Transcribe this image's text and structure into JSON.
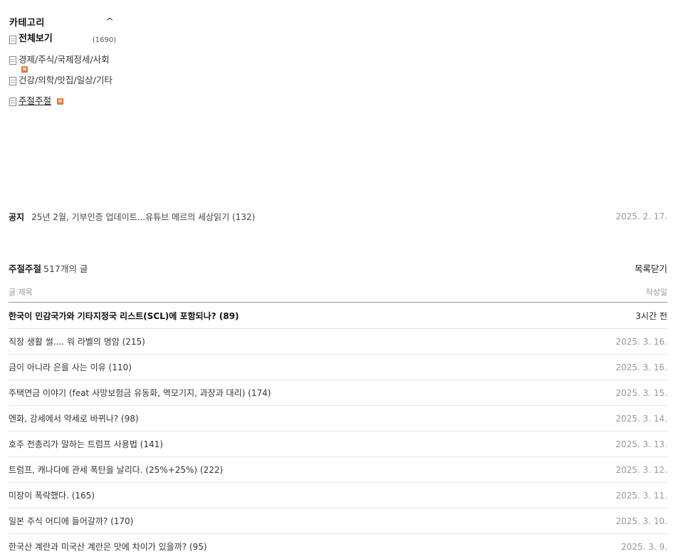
{
  "category": {
    "title": "카테고리",
    "collapse_icon": "caret-up-icon",
    "items": [
      {
        "label": "전체보기",
        "count": "(1690)"
      },
      {
        "label": "경제/주식/국제정세/사회",
        "badge": "N"
      },
      {
        "label": "건강/의학/맛집/일상/기타"
      },
      {
        "label": "주절주절",
        "badge": "N"
      }
    ]
  },
  "notice": {
    "label": "공지",
    "text": "25년 2월, 기부인증 업데이트...유튜브 메르의 세상읽기 (132)",
    "date": "2025. 2. 17."
  },
  "list": {
    "board_name": "주절주절",
    "post_count": "517개의 글",
    "close_label": "목록닫기",
    "col_title": "글 제목",
    "col_date": "작성일",
    "rows": [
      {
        "title": "한국이 민감국가와 기타지정국 리스트(SCL)에 포함되나? (89)",
        "date": "3시간 전"
      },
      {
        "title": "직장 생활 썰.... 워 라벨의 명암 (215)",
        "date": "2025. 3. 16."
      },
      {
        "title": "금이 아니라 은을 사는 이유 (110)",
        "date": "2025. 3. 16."
      },
      {
        "title": "주택연금 이야기 (feat 사망보험금 유동화, 역모기지, 과장과 대리) (174)",
        "date": "2025. 3. 15."
      },
      {
        "title": "엔화, 강세에서 약세로 바뀌나? (98)",
        "date": "2025. 3. 14."
      },
      {
        "title": "호주 전총리가 말하는 트럼프 사용법 (141)",
        "date": "2025. 3. 13."
      },
      {
        "title": "트럼프, 캐나다에 관세 폭탄을 날리다. (25%+25%) (222)",
        "date": "2025. 3. 12."
      },
      {
        "title": "미장이 폭락했다. (165)",
        "date": "2025. 3. 11."
      },
      {
        "title": "일본 주식 어디에 들어갈까? (170)",
        "date": "2025. 3. 10."
      },
      {
        "title": "한국산 계란과 미국산 계란은 맛에 차이가 있을까? (95)",
        "date": "2025. 3. 9."
      }
    ]
  },
  "colors": {
    "new_badge": "#e07a3a",
    "date_gray": "#999999"
  }
}
